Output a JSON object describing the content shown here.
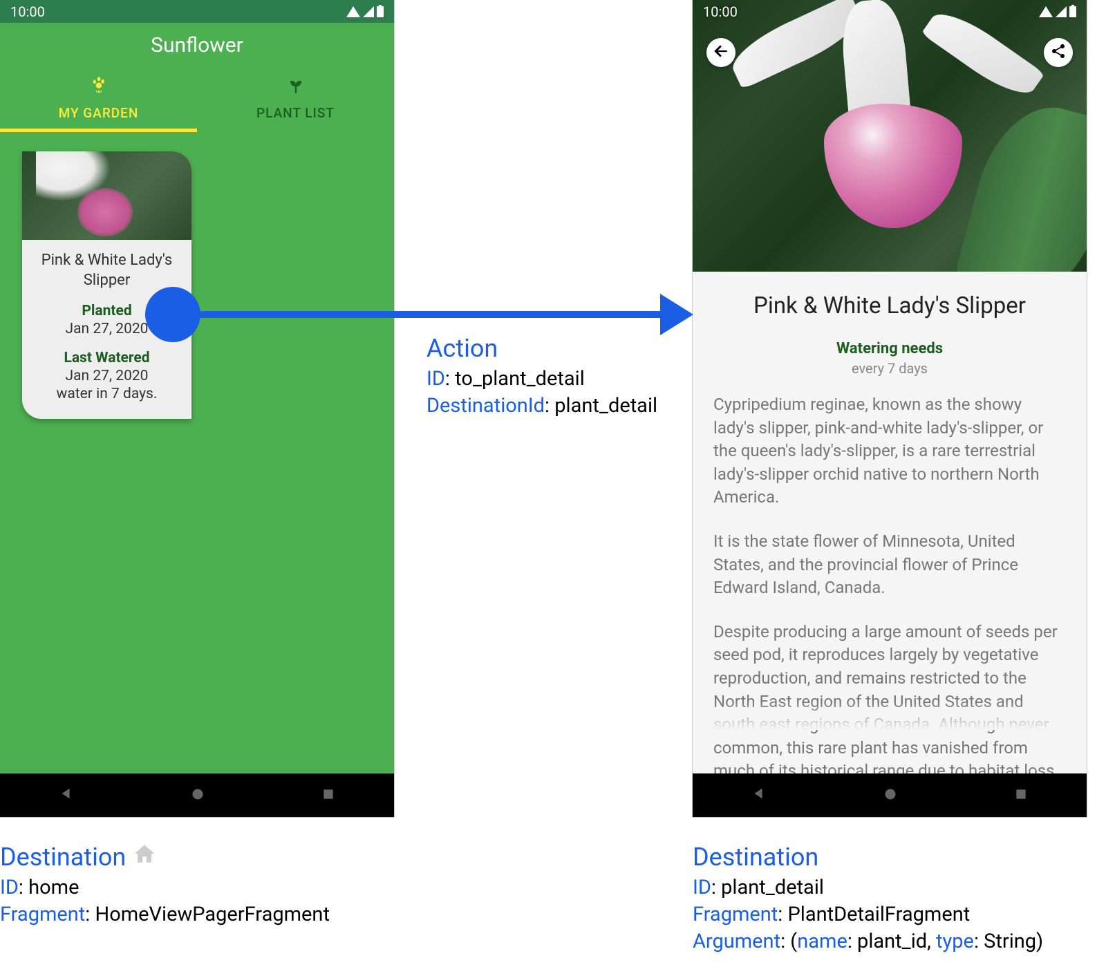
{
  "status": {
    "time": "10:00"
  },
  "leftPhone": {
    "title": "Sunflower",
    "tabs": [
      {
        "label": "MY GARDEN",
        "icon": "flower-icon",
        "active": true
      },
      {
        "label": "PLANT LIST",
        "icon": "sprout-icon",
        "active": false
      }
    ],
    "card": {
      "title": "Pink & White Lady's Slipper",
      "plantedLabel": "Planted",
      "plantedDate": "Jan 27, 2020",
      "wateredLabel": "Last Watered",
      "wateredDate": "Jan 27, 2020",
      "wateredNote": "water in 7 days."
    }
  },
  "rightPhone": {
    "title": "Pink & White Lady's Slipper",
    "wateringHeader": "Watering needs",
    "wateringValue": "every 7 days",
    "paragraphs": [
      "Cypripedium reginae, known as the showy lady's slipper, pink-and-white lady's-slipper, or the queen's lady's-slipper, is a rare terrestrial lady's-slipper orchid native to northern North America.",
      "It is the state flower of Minnesota, United States, and the provincial flower of Prince Edward Island, Canada.",
      "Despite producing a large amount of seeds per seed pod, it reproduces largely by vegetative reproduction, and remains restricted to the North East region of the United States and south east regions of Canada. Although never common, this rare plant has vanished from much of its historical range due to habitat loss. It has"
    ]
  },
  "action": {
    "heading": "Action",
    "idLabel": "ID",
    "idValue": "to_plant_detail",
    "destLabel": "DestinationId",
    "destValue": "plant_detail"
  },
  "destLeft": {
    "heading": "Destination",
    "idLabel": "ID",
    "idValue": "home",
    "fragLabel": "Fragment",
    "fragValue": "HomeViewPagerFragment"
  },
  "destRight": {
    "heading": "Destination",
    "idLabel": "ID",
    "idValue": "plant_detail",
    "fragLabel": "Fragment",
    "fragValue": "PlantDetailFragment",
    "argLabel": "Argument",
    "argName": "name",
    "argNameValue": "plant_id",
    "argType": "type",
    "argTypeValue": "String"
  }
}
